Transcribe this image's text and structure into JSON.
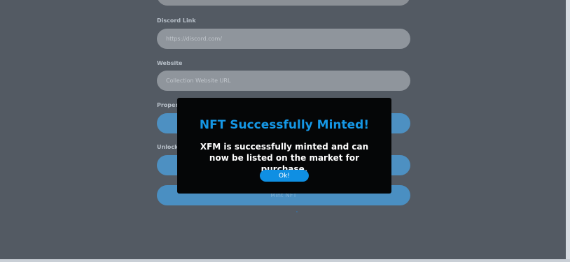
{
  "form": {
    "discord": {
      "label": "Discord Link",
      "placeholder": "https://discord.com/"
    },
    "website": {
      "label": "Website",
      "placeholder": "Collection Website URL"
    },
    "properties": {
      "label": "Propert"
    },
    "unlockable": {
      "label": "Unlocka"
    },
    "mint_button": "Mint NFT"
  },
  "modal": {
    "title": "NFT Successfully Minted!",
    "message": "XFM is successfully minted and can now be listed on the market for purchase.",
    "ok_label": "Ok!"
  },
  "colors": {
    "backdrop": "#535a63",
    "accent": "#1597e5",
    "modal_bg": "#050607"
  }
}
